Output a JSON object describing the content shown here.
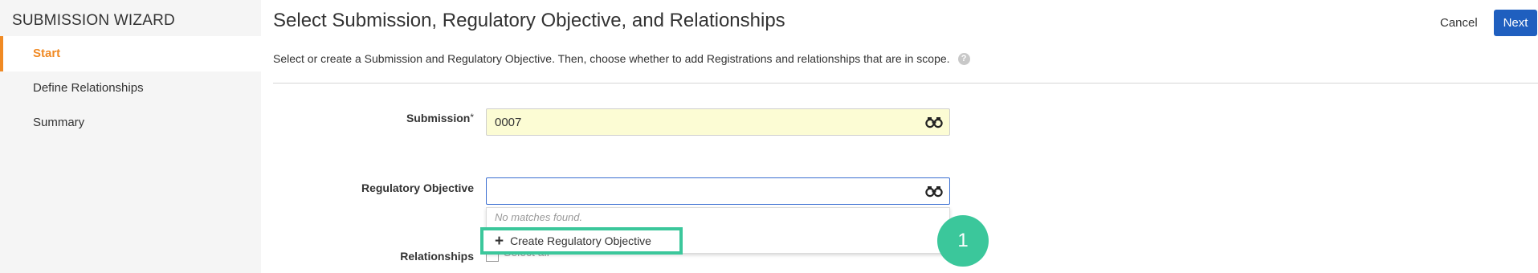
{
  "sidebar": {
    "title": "SUBMISSION WIZARD",
    "items": [
      {
        "label": "Start",
        "active": true
      },
      {
        "label": "Define Relationships",
        "active": false
      },
      {
        "label": "Summary",
        "active": false
      }
    ]
  },
  "header": {
    "title": "Select Submission, Regulatory Objective, and Relationships",
    "cancel_label": "Cancel",
    "next_label": "Next"
  },
  "instructions": "Select or create a Submission and Regulatory Objective. Then, choose whether to add Registrations and relationships that are in scope.",
  "form": {
    "submission": {
      "label": "Submission",
      "required_mark": "*",
      "value": "0007"
    },
    "regulatory_objective": {
      "label": "Regulatory Objective",
      "value": ""
    },
    "dropdown": {
      "no_matches": "No matches found.",
      "create_option": "Create Regulatory Objective"
    },
    "relationships": {
      "label": "Relationships",
      "checkbox_label": "Select all"
    }
  },
  "annotation": {
    "step": "1"
  },
  "colors": {
    "accent": "#f08a24",
    "primary_button": "#1f5fbf",
    "highlight": "#3bc79b",
    "submission_field_bg": "#fcfcd4",
    "focus_border": "#3b6fd1"
  },
  "icons": {
    "lookup": "binoculars-icon",
    "help": "question-circle-icon",
    "create": "plus-icon"
  }
}
